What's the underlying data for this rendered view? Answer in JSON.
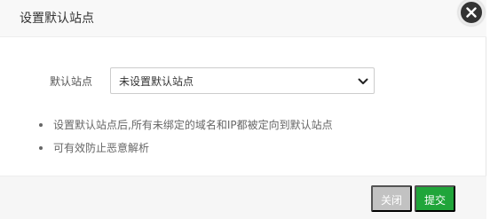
{
  "dialog": {
    "title": "设置默认站点",
    "close_icon": "close-icon"
  },
  "form": {
    "label": "默认站点",
    "select_value": "未设置默认站点",
    "select_icon": "chevron-down-icon"
  },
  "tips": [
    "设置默认站点后,所有未绑定的域名和IP都被定向到默认站点",
    "可有效防止恶意解析"
  ],
  "footer": {
    "close_label": "关闭",
    "submit_label": "提交"
  },
  "colors": {
    "submit_green": "#20a53a",
    "close_gray": "#c2c2c2",
    "header_bg": "#f8f8f8",
    "close_x_bg": "#333333"
  }
}
